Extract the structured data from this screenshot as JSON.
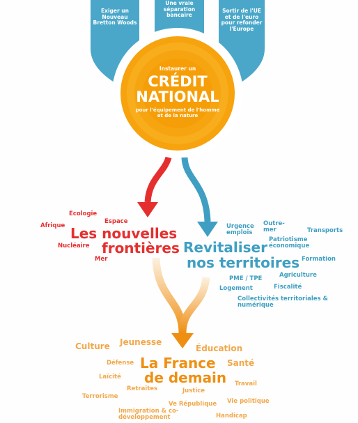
{
  "pillars": {
    "left": "Exiger un Nouveau Bretton Woods",
    "center": "Une vraie séparation bancaire",
    "right": "Sortir de l'UE et de l'euro pour refonder l'Europe"
  },
  "center_circle": {
    "pre": "Instaurer un",
    "title_line1": "CRÉDIT",
    "title_line2": "NATIONAL",
    "post": "pour l'équipement de l'homme et de la nature"
  },
  "left_branch": {
    "title_line1": "Les nouvelles",
    "title_line2": "frontières",
    "items": [
      "Ecologie",
      "Espace",
      "Afrique",
      "Nucléaire",
      "Mer"
    ]
  },
  "right_branch": {
    "title_line1": "Revitaliser",
    "title_line2": "nos territoires",
    "items": [
      "Urgence emplois",
      "Outre-mer",
      "Transports",
      "Patriotisme économique",
      "Formation",
      "Agriculture",
      "PME / TPE",
      "Logement",
      "Fiscalité",
      "Collectivités territoriales & numérique"
    ]
  },
  "bottom": {
    "title_line1": "La France",
    "title_line2": "de demain",
    "items": [
      "Culture",
      "Jeunesse",
      "Éducation",
      "Défense",
      "Santé",
      "Laïcité",
      "Retraites",
      "Travail",
      "Justice",
      "Terrorisme",
      "Ve République",
      "Vie politique",
      "Immigration & co-développement",
      "Handicap"
    ]
  },
  "colors": {
    "blue": "#3f9fc2",
    "red": "#e52f2f",
    "orange": "#f2a84b",
    "orange_dark": "#ef8f12",
    "pillar_blue": "#4aa7c9"
  }
}
